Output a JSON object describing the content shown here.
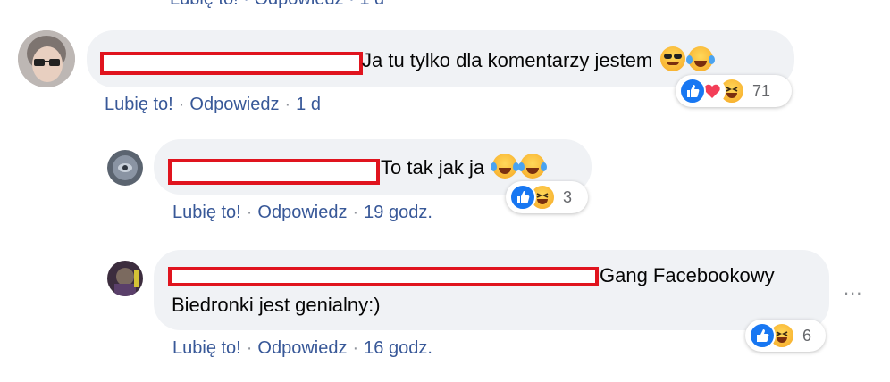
{
  "top_row": {
    "text": "Lubię to! · Odpowiedz · 1 d"
  },
  "comments": [
    {
      "text": "Ja tu tylko dla komentarzy jestem",
      "actions": {
        "like": "Lubię to!",
        "reply": "Odpowiedz",
        "time": "1 d"
      },
      "reactions": {
        "icons": [
          "like-icon",
          "love-icon",
          "haha-icon"
        ],
        "count": "71"
      },
      "emojis": [
        "sunglasses-emoji",
        "joy-emoji"
      ]
    },
    {
      "text": "To tak jak ja",
      "actions": {
        "like": "Lubię to!",
        "reply": "Odpowiedz",
        "time": "19 godz."
      },
      "reactions": {
        "icons": [
          "like-icon",
          "haha-icon"
        ],
        "count": "3"
      },
      "emojis": [
        "joy-emoji",
        "joy-emoji"
      ]
    },
    {
      "text_line1": "Gang Facebookowy",
      "text_line2": "Biedronki jest genialny:)",
      "actions": {
        "like": "Lubię to!",
        "reply": "Odpowiedz",
        "time": "16 godz."
      },
      "reactions": {
        "icons": [
          "like-icon",
          "haha-icon"
        ],
        "count": "6"
      }
    }
  ],
  "more_label": "...",
  "colors": {
    "link": "#385898",
    "bubble": "#f0f2f5",
    "redaction": "#e0141e",
    "like": "#1877f2",
    "love": "#f33e58"
  }
}
